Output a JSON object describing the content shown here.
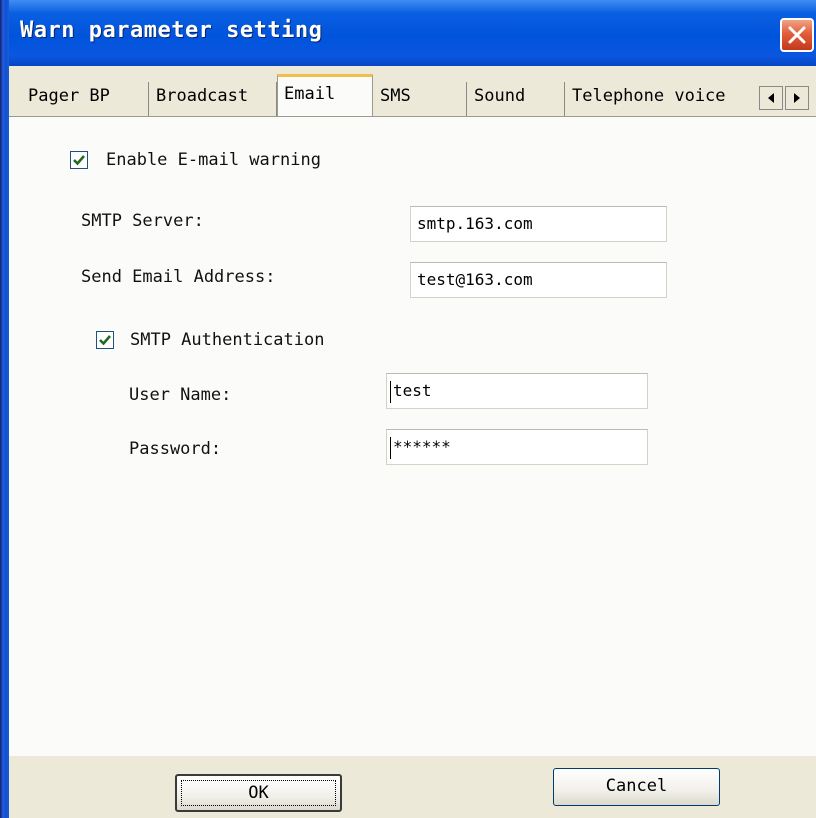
{
  "window": {
    "title": "Warn parameter setting",
    "close_icon": "close-icon"
  },
  "tabs": [
    {
      "label": "Pager BP",
      "active": false
    },
    {
      "label": "Broadcast",
      "active": false
    },
    {
      "label": "Email",
      "active": true
    },
    {
      "label": "SMS",
      "active": false
    },
    {
      "label": "Sound",
      "active": false
    },
    {
      "label": "Telephone voice",
      "active": false
    }
  ],
  "tab_scroll": {
    "left_icon": "scroll-left-icon",
    "right_icon": "scroll-right-icon"
  },
  "email": {
    "enable_label": "Enable E-mail warning",
    "enable_checked": true,
    "smtp_server_label": "SMTP Server:",
    "smtp_server_value": "smtp.163.com",
    "send_address_label": "Send Email Address:",
    "send_address_value": "test@163.com",
    "auth_label": "SMTP Authentication",
    "auth_checked": true,
    "username_label": "User Name:",
    "username_value": "test",
    "password_label": "Password:",
    "password_value": "******"
  },
  "buttons": {
    "ok": "OK",
    "cancel": "Cancel"
  },
  "colors": {
    "title_bar": "#0053db",
    "dialog_bg": "#ece9d8",
    "panel_bg": "#fbfbf9",
    "close_button": "#e35d3a",
    "active_tab_accent": "#f0c04f"
  }
}
